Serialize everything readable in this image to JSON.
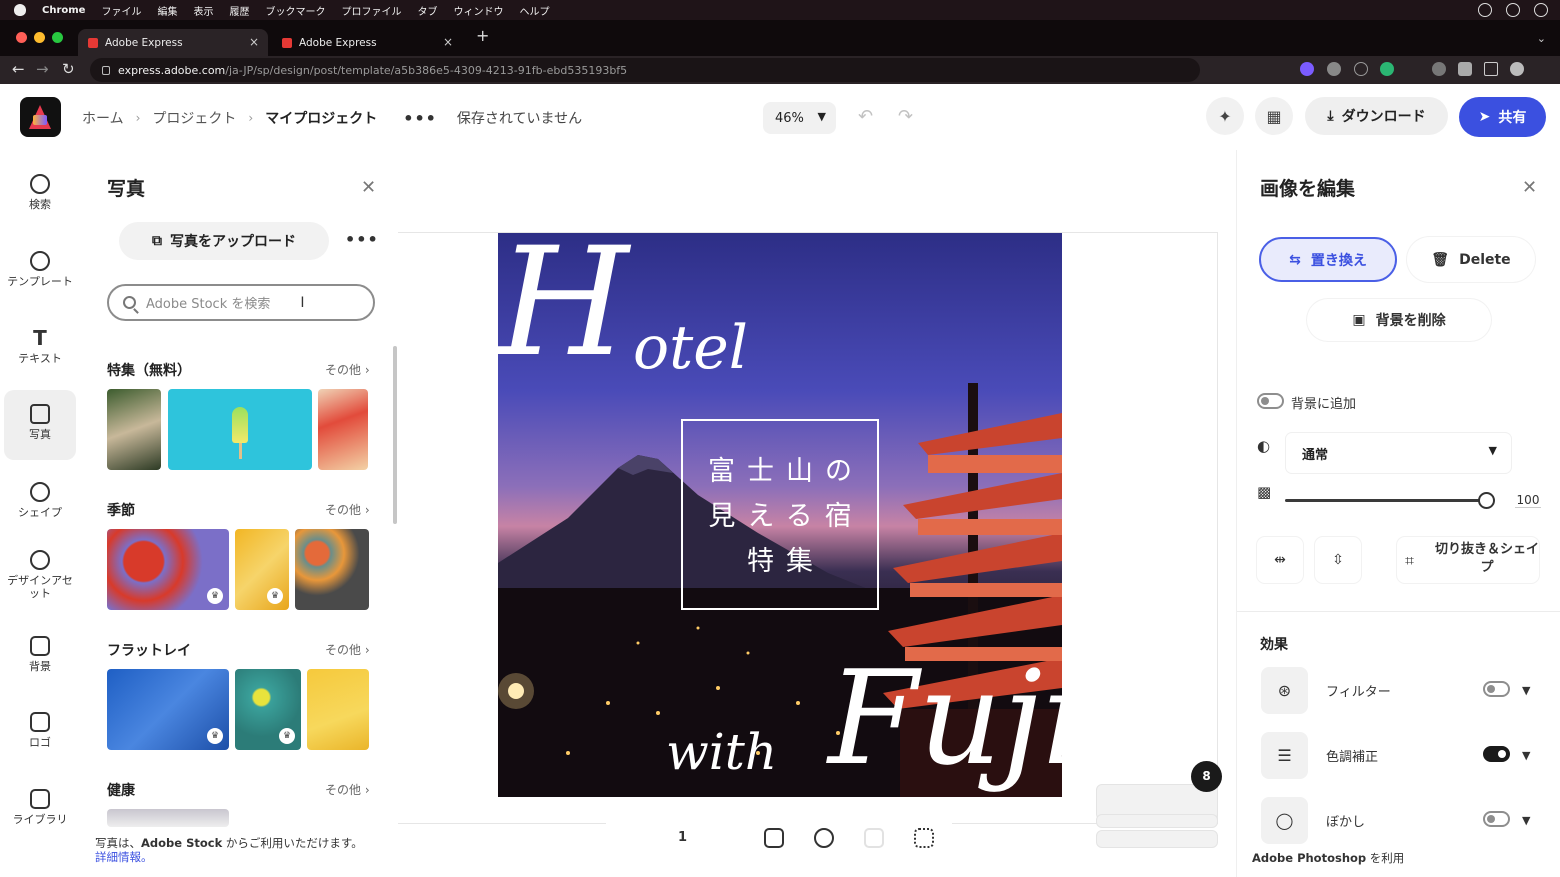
{
  "menubar": {
    "items": [
      "Chrome",
      "ファイル",
      "編集",
      "表示",
      "履歴",
      "ブックマーク",
      "プロファイル",
      "タブ",
      "ウィンドウ",
      "ヘルプ"
    ]
  },
  "browser": {
    "tabs": [
      {
        "title": "Adobe Express"
      },
      {
        "title": "Adobe Express"
      }
    ],
    "url_host": "express.adobe.com",
    "url_path": "/ja-JP/sp/design/post/template/a5b386e5-4309-4213-91fb-ebd535193bf5"
  },
  "header": {
    "breadcrumb": {
      "home": "ホーム",
      "projects": "プロジェクト",
      "current": "マイプロジェクト"
    },
    "save_status": "保存されていません",
    "zoom": "46%",
    "download_label": "ダウンロード",
    "share_label": "共有"
  },
  "rail": {
    "items": [
      {
        "label": "検索",
        "icon": "search-icon"
      },
      {
        "label": "テンプレート",
        "icon": "template-icon"
      },
      {
        "label": "テキスト",
        "icon": "text-icon"
      },
      {
        "label": "写真",
        "icon": "photo-icon",
        "active": true
      },
      {
        "label": "シェイプ",
        "icon": "shape-icon"
      },
      {
        "label": "デザインアセット",
        "icon": "design-assets-icon"
      },
      {
        "label": "背景",
        "icon": "background-icon"
      },
      {
        "label": "ロゴ",
        "icon": "logo-icon"
      },
      {
        "label": "ライブラリ",
        "icon": "library-icon"
      }
    ]
  },
  "photos_panel": {
    "title": "写真",
    "upload_label": "写真をアップロード",
    "search_placeholder": "Adobe Stock を検索",
    "sections": [
      {
        "title": "特集（無料）",
        "more": "その他 ›"
      },
      {
        "title": "季節",
        "more": "その他 ›"
      },
      {
        "title": "フラットレイ",
        "more": "その他 ›"
      },
      {
        "title": "健康",
        "more": "その他 ›"
      }
    ],
    "credit_prefix": "写真は、",
    "credit_brand": "Adobe Stock",
    "credit_suffix": " からご利用いただけます。",
    "credit_link": "詳細情報。"
  },
  "canvas": {
    "script_hotel_h": "H",
    "script_hotel_rest": "otel",
    "title_line1": "富士山の",
    "title_line2": "見える宿",
    "title_line3": "特集",
    "script_with": "with",
    "script_fuji": "Fuji",
    "page_number": "1",
    "badge_count": "8"
  },
  "edit_panel": {
    "title": "画像を編集",
    "replace_label": "置き換え",
    "delete_label": "Delete",
    "remove_bg_label": "背景を削除",
    "add_to_bg_label": "背景に追加",
    "blend_mode": "通常",
    "opacity": "100",
    "crop_label": "切り抜き＆シェイプ",
    "effects_title": "効果",
    "effects": [
      {
        "label": "フィルター",
        "enabled": false
      },
      {
        "label": "色調補正",
        "enabled": true
      },
      {
        "label": "ぼかし",
        "enabled": false
      }
    ],
    "photoshop_brand": "Adobe Photoshop",
    "photoshop_suffix": " を利用"
  },
  "colors": {
    "accent": "#3b50e0",
    "replace_bg": "#e9ebfc"
  }
}
